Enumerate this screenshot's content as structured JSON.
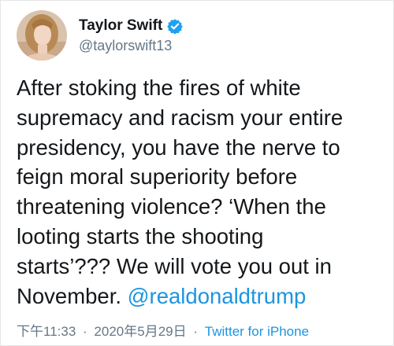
{
  "user": {
    "display_name": "Taylor Swift",
    "handle": "@taylorswift13",
    "verified": true,
    "verified_badge_color": "#1da1f2",
    "avatar_icon": "profile-photo-icon"
  },
  "tweet": {
    "text_lines": [
      "After stoking the fires of white",
      "supremacy and racism your entire",
      "presidency, you have the nerve to",
      "feign moral superiority before",
      "threatening violence? ‘When the",
      "looting starts the shooting",
      "starts’??? We will vote you out in",
      "November."
    ],
    "mention": "@realdonaldtrump",
    "mention_color": "#1b95e0"
  },
  "meta": {
    "time": "下午11:33",
    "separator": "·",
    "date": "2020年5月29日",
    "source": "Twitter for iPhone"
  }
}
